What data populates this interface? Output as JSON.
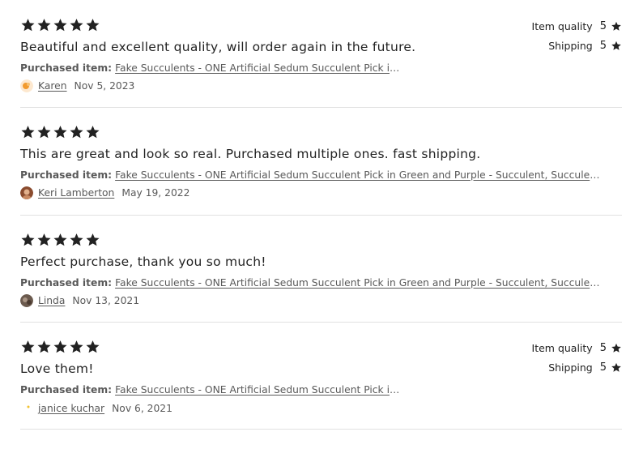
{
  "reviews": [
    {
      "rating": 5,
      "text": "Beautiful and excellent quality, will order again in the future.",
      "purchased_label": "Purchased item:",
      "item": "Fake Succulents - ONE Artificial Sedum Succulent Pick in Green and Purple - Succulent, Succulents, Artificial Succulents",
      "author": "Karen",
      "date": "Nov 5, 2023",
      "sub_ratings": [
        {
          "label": "Item quality",
          "value": "5"
        },
        {
          "label": "Shipping",
          "value": "5"
        }
      ]
    },
    {
      "rating": 5,
      "text": "This are great and look so real. Purchased multiple ones. fast shipping.",
      "purchased_label": "Purchased item:",
      "item": "Fake Succulents - ONE Artificial Sedum Succulent Pick in Green and Purple - Succulent, Succulents, Artificial Succulents",
      "author": "Keri Lamberton",
      "date": "May 19, 2022"
    },
    {
      "rating": 5,
      "text": "Perfect purchase, thank you so much!",
      "purchased_label": "Purchased item:",
      "item": "Fake Succulents - ONE Artificial Sedum Succulent Pick in Green and Purple - Succulent, Succulents, Artificial Succulents",
      "author": "Linda",
      "date": "Nov 13, 2021"
    },
    {
      "rating": 5,
      "text": "Love them!",
      "purchased_label": "Purchased item:",
      "item": "Fake Succulents - ONE Artificial Sedum Succulent Pick in Green and Purple - Succulent, Succulents, Artificial Succulents",
      "author": "janice kuchar",
      "date": "Nov 6, 2021",
      "sub_ratings": [
        {
          "label": "Item quality",
          "value": "5"
        },
        {
          "label": "Shipping",
          "value": "5"
        }
      ]
    }
  ],
  "colors": {
    "star": "#222222",
    "muted_text": "#595959",
    "divider": "#e1e1e1"
  }
}
